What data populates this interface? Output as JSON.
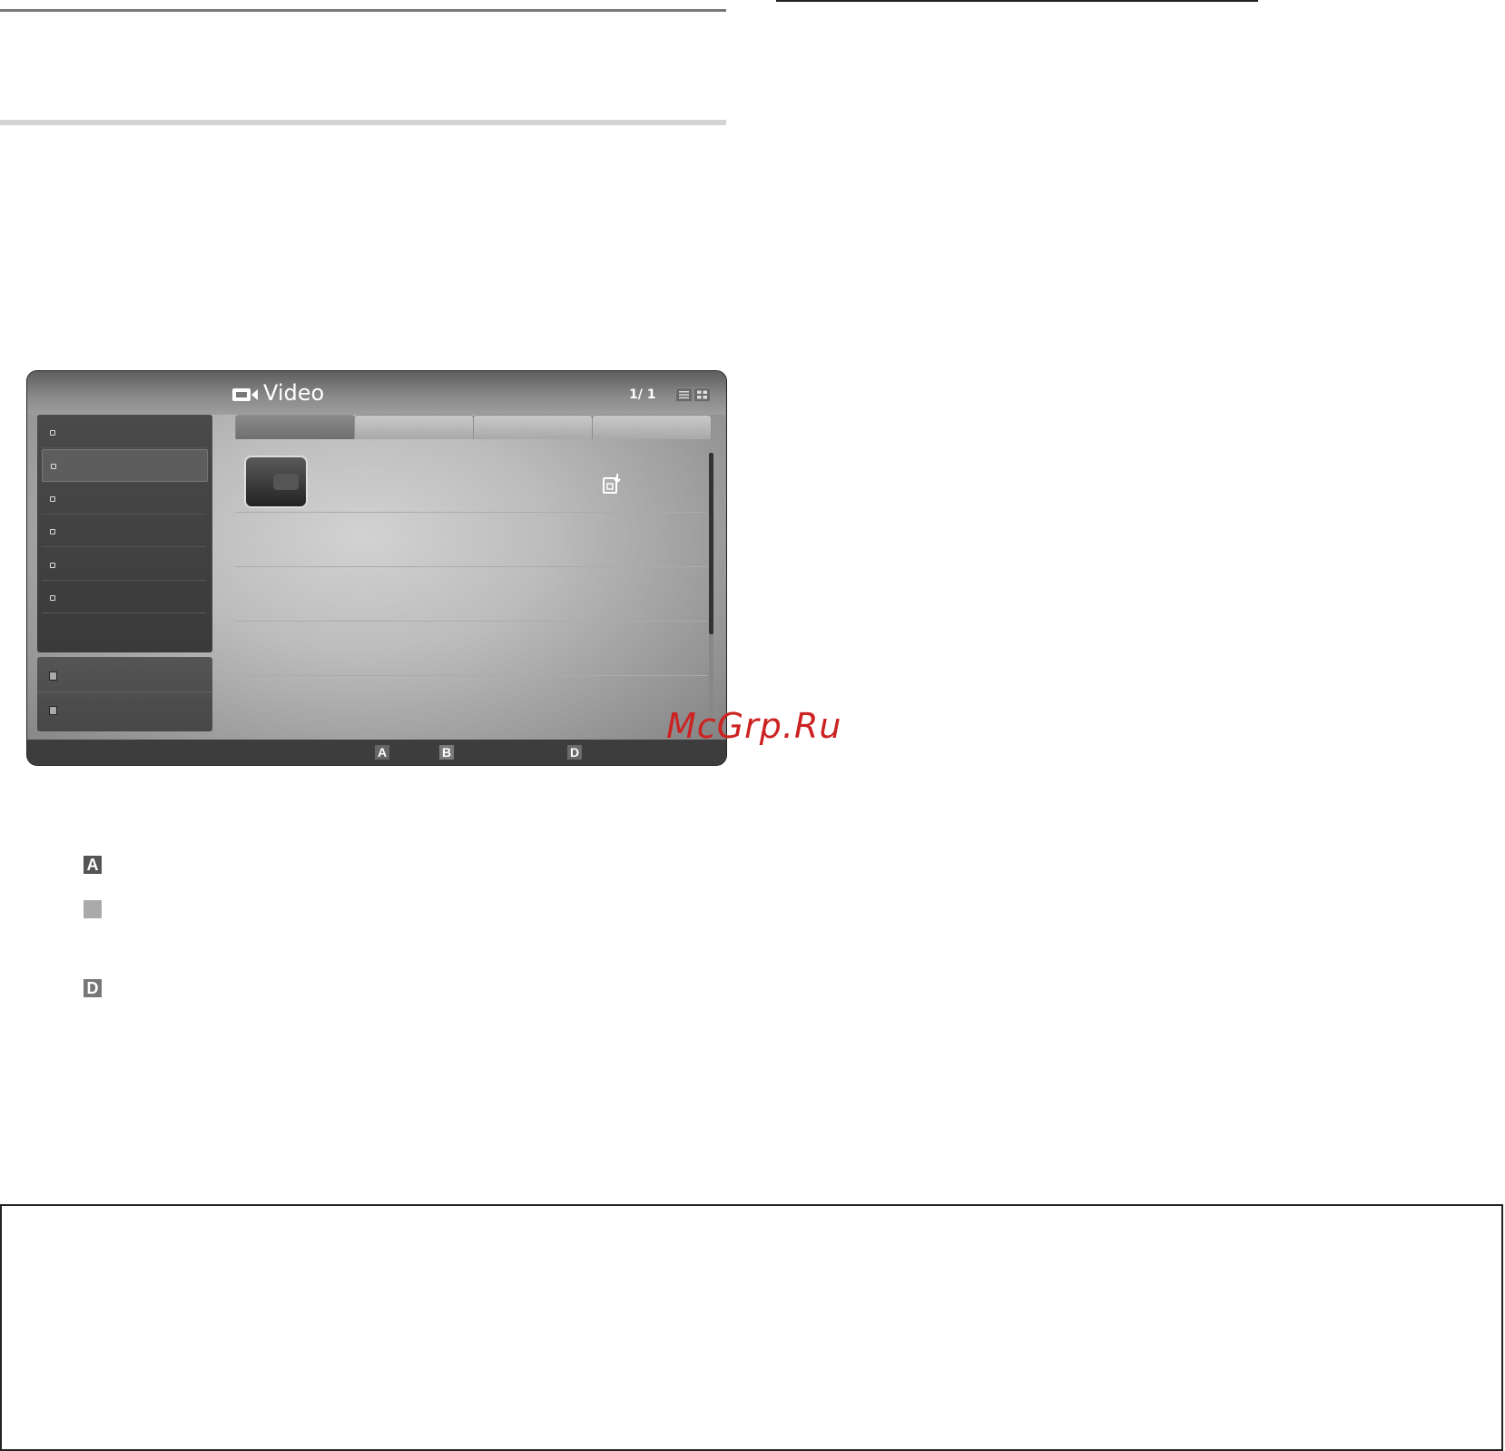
{
  "screen": {
    "title": "Video",
    "page_counter": "1/ 1",
    "color_keys": [
      "A",
      "B",
      "D"
    ]
  },
  "legend": {
    "key_a": "A",
    "key_d": "D"
  },
  "watermark": "McGrp.Ru",
  "colors": {
    "watermark": "#cc2222",
    "footer_bar": "#3d3d3d",
    "sidebar": "#404040"
  },
  "icons": {
    "title": "video-camera-icon",
    "copy": "copy-to-device-icon",
    "view_list": "list-view-icon",
    "view_thumb": "thumbnail-view-icon"
  }
}
